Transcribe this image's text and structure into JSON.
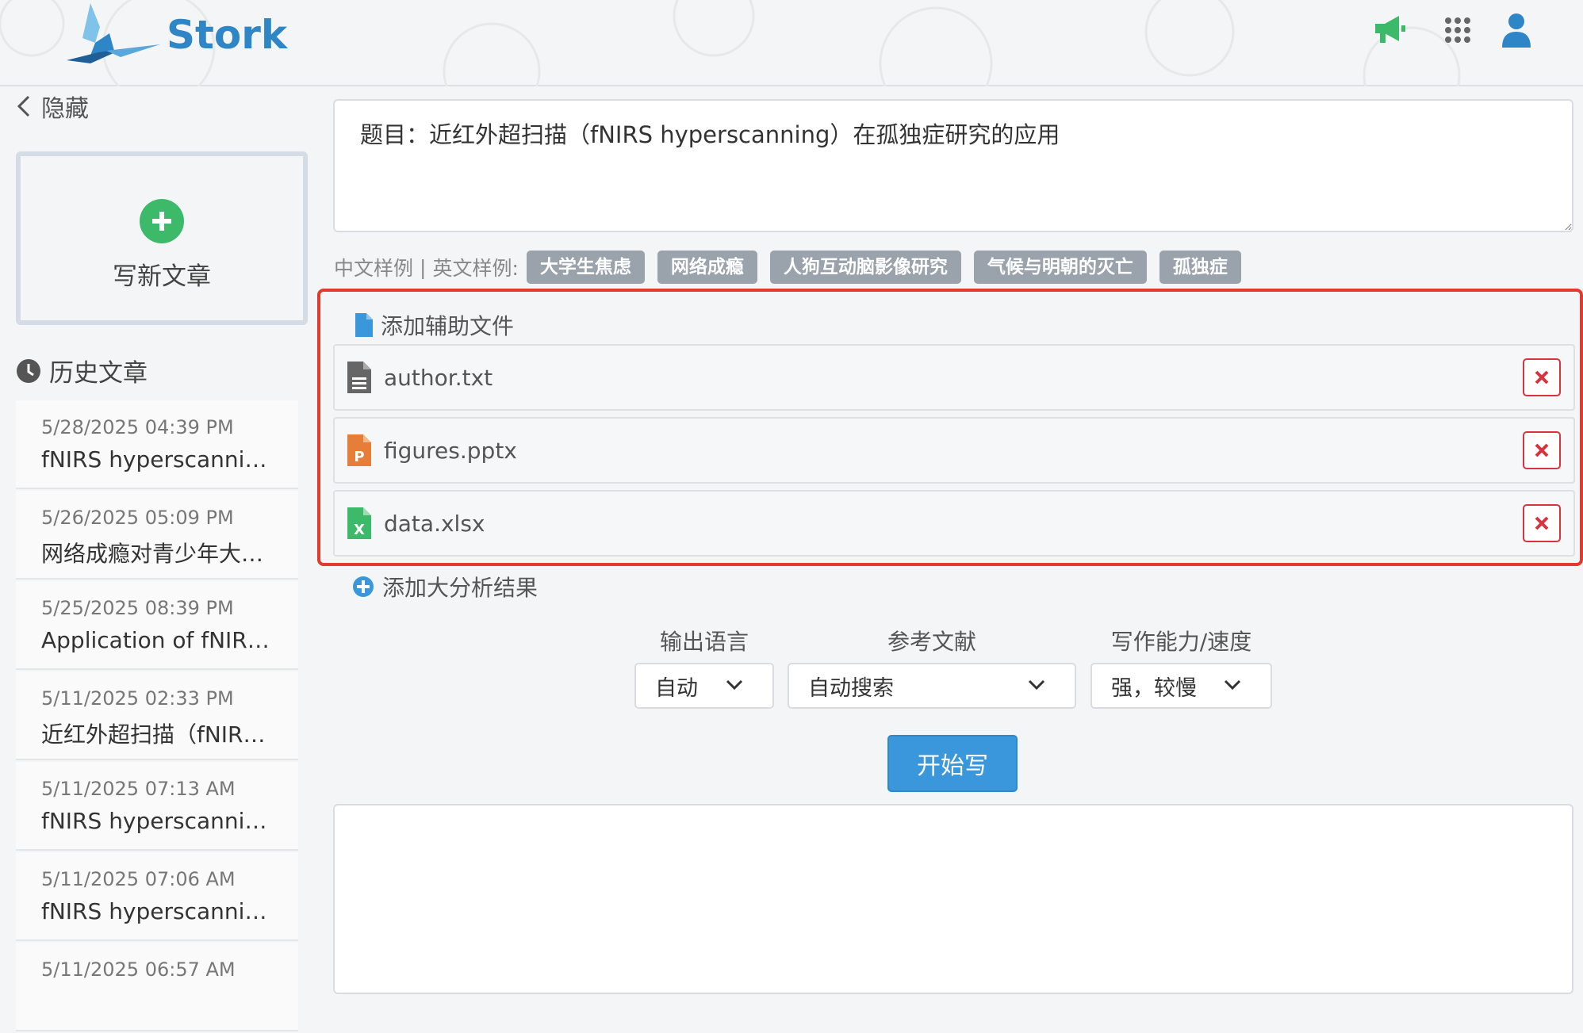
{
  "app": {
    "name": "Stork"
  },
  "sidebar": {
    "hide_label": "隐藏",
    "new_article_label": "写新文章",
    "history_title": "历史文章",
    "history": [
      {
        "date": "5/28/2025 04:39 PM",
        "title": "fNIRS hyperscannin…"
      },
      {
        "date": "5/26/2025 05:09 PM",
        "title": "网络成瘾对青少年大…"
      },
      {
        "date": "5/25/2025 08:39 PM",
        "title": "Application of fNIR…"
      },
      {
        "date": "5/11/2025 02:33 PM",
        "title": "近红外超扫描（fNIRS…"
      },
      {
        "date": "5/11/2025 07:13 AM",
        "title": "fNIRS hyperscannin…"
      },
      {
        "date": "5/11/2025 07:06 AM",
        "title": "fNIRS hyperscannin…"
      },
      {
        "date": "5/11/2025 06:57 AM",
        "title": ""
      }
    ]
  },
  "main": {
    "topic_value": "题目：近红外超扫描（fNIRS hyperscanning）在孤独症研究的应用",
    "examples": {
      "zh_label": "中文样例",
      "separator": "|",
      "en_label": "英文样例:",
      "tags": [
        "大学生焦虑",
        "网络成瘾",
        "人狗互动脑影像研究",
        "气候与明朝的灭亡",
        "孤独症"
      ]
    },
    "add_file_label": "添加辅助文件",
    "files": [
      {
        "name": "author.txt",
        "icon": "text-file-icon",
        "color": "#666666"
      },
      {
        "name": "figures.pptx",
        "icon": "powerpoint-file-icon",
        "color": "#e67e3a"
      },
      {
        "name": "data.xlsx",
        "icon": "excel-file-icon",
        "color": "#3cba6a"
      }
    ],
    "add_analysis_label": "添加大分析结果",
    "options": {
      "language": {
        "label": "输出语言",
        "value": "自动"
      },
      "references": {
        "label": "参考文献",
        "value": "自动搜索"
      },
      "ability": {
        "label": "写作能力/速度",
        "value": "强，较慢"
      }
    },
    "start_label": "开始写"
  },
  "colors": {
    "brand": "#2f86c6",
    "green": "#3cba6a",
    "highlight_border": "#e23a2c",
    "remove": "#d8343f",
    "button": "#3a97dc"
  }
}
